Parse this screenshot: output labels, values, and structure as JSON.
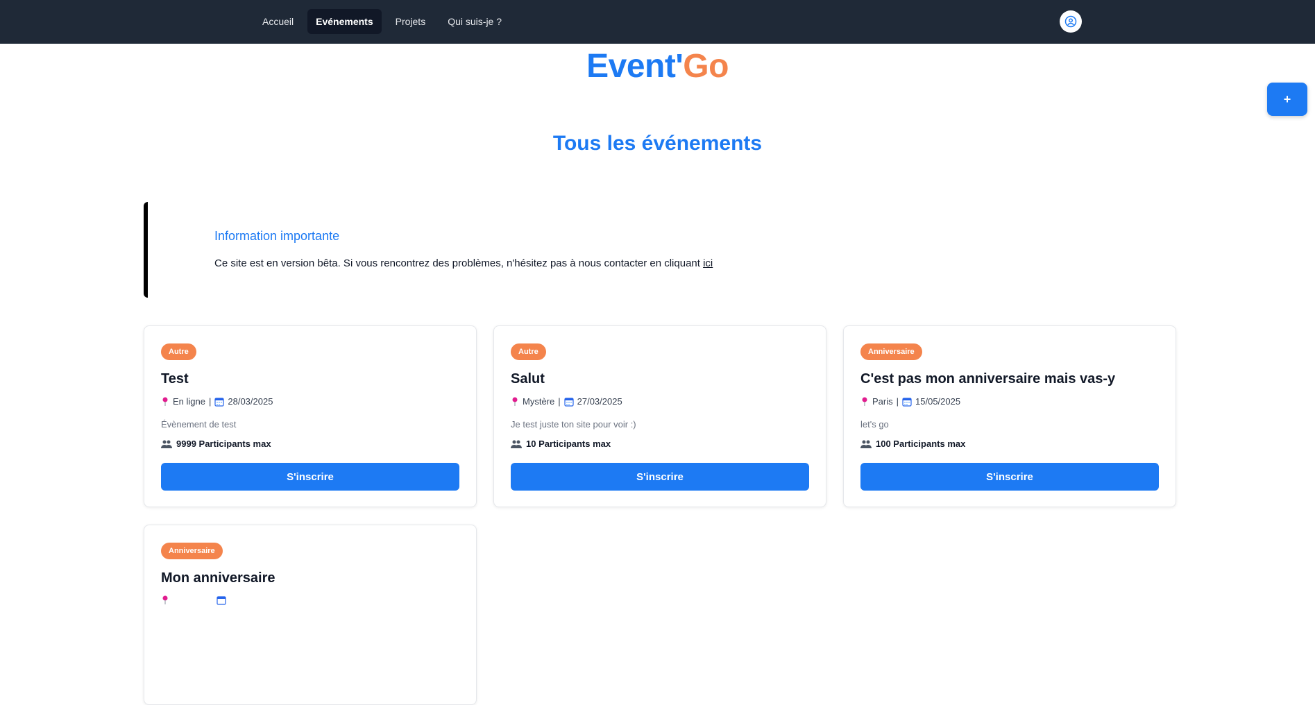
{
  "nav": {
    "items": [
      {
        "label": "Accueil"
      },
      {
        "label": "Evénements"
      },
      {
        "label": "Projets"
      },
      {
        "label": "Qui suis-je ?"
      }
    ]
  },
  "brand": {
    "part1": "Event'",
    "part2": "Go"
  },
  "add_button": {
    "label": "+"
  },
  "page_title": "Tous les événements",
  "notice": {
    "title": "Information importante",
    "text": "Ce site est en version bêta. Si vous rencontrez des problèmes, n'hésitez pas à nous contacter en cliquant ",
    "link_label": "ici"
  },
  "events": [
    {
      "category": "Autre",
      "title": "Test",
      "location": "En ligne",
      "separator": " |",
      "date": "28/03/2025",
      "description": "Évènement de test",
      "capacity": "9999 Participants max",
      "cta": "S'inscrire"
    },
    {
      "category": "Autre",
      "title": "Salut",
      "location": "Mystère",
      "separator": " |",
      "date": "27/03/2025",
      "description": "Je test juste ton site pour voir :)",
      "capacity": "10 Participants max",
      "cta": "S'inscrire"
    },
    {
      "category": "Anniversaire",
      "title": "C'est pas mon anniversaire mais vas-y",
      "location": "Paris",
      "separator": " |",
      "date": "15/05/2025",
      "description": "let's go",
      "capacity": "100 Participants max",
      "cta": "S'inscrire"
    },
    {
      "category": "Anniversaire",
      "title": "Mon anniversaire"
    }
  ],
  "colors": {
    "primary": "#1d7af3",
    "accent": "#f4844c",
    "navbar": "#1f2937"
  }
}
